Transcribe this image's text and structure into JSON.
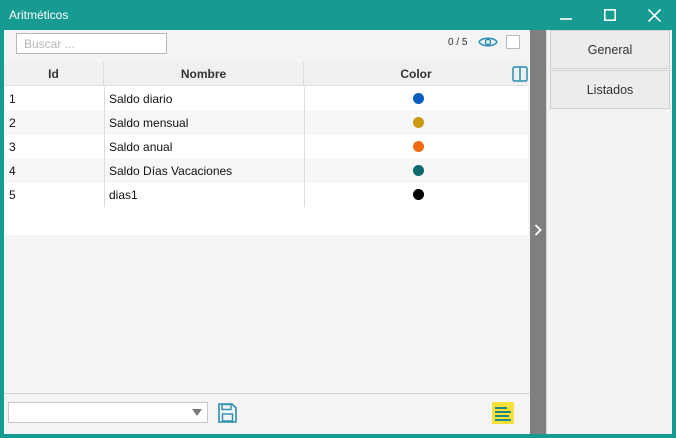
{
  "window": {
    "title": "Aritméticos",
    "accent_color": "#159b92"
  },
  "toolbar": {
    "search_placeholder": "Buscar ...",
    "search_value": "",
    "count_text": "0 / 5"
  },
  "grid": {
    "columns": [
      "Id",
      "Nombre",
      "Color"
    ],
    "rows": [
      {
        "id": "1",
        "name": "Saldo diario",
        "color": "#0a5cbf"
      },
      {
        "id": "2",
        "name": "Saldo mensual",
        "color": "#c99a10"
      },
      {
        "id": "3",
        "name": "Saldo anual",
        "color": "#f06a14"
      },
      {
        "id": "4",
        "name": "Saldo Días Vacaciones",
        "color": "#0d6b6e"
      },
      {
        "id": "5",
        "name": "dias1",
        "color": "#000000"
      }
    ]
  },
  "footer": {
    "combo_value": ""
  },
  "side_tabs": [
    "General",
    "Listados"
  ],
  "icons": {
    "minimize": "minimize-icon",
    "maximize": "maximize-icon",
    "close": "close-icon",
    "visibility": "eye-icon",
    "columns": "columns-icon",
    "save": "save-icon",
    "report": "report-icon",
    "expand": "chevron-right-icon",
    "dropdown": "chevron-down-icon"
  }
}
